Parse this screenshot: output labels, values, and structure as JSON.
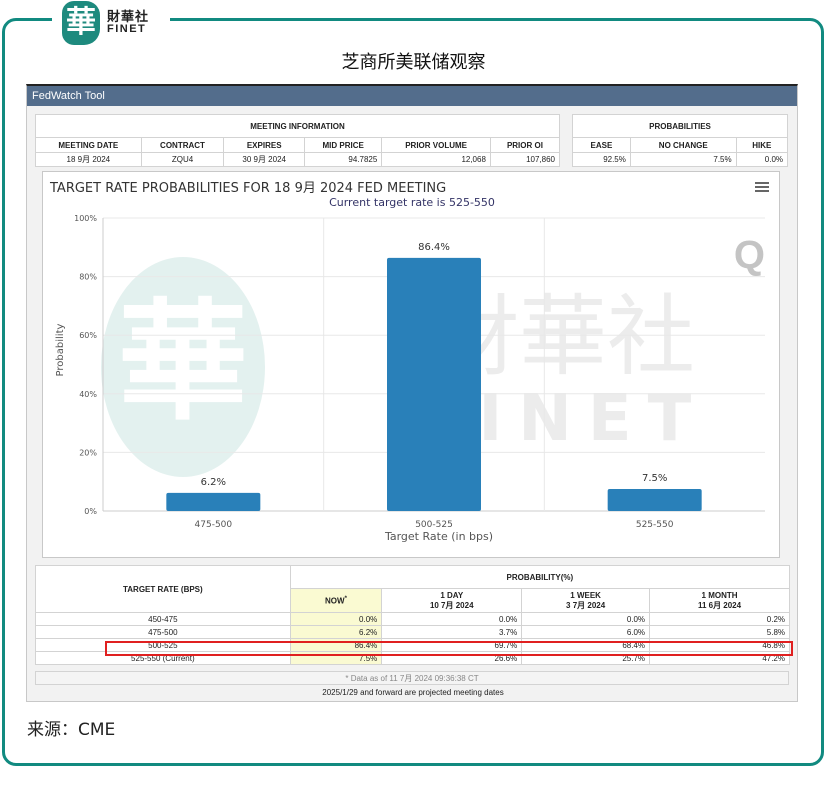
{
  "brand": {
    "logo_glyph": "華",
    "name_cn": "財華社",
    "name_en": "FINET"
  },
  "page_title": "芝商所美联储观察",
  "tool_title": "FedWatch Tool",
  "meeting_info": {
    "header": "MEETING INFORMATION",
    "columns": [
      "MEETING DATE",
      "CONTRACT",
      "EXPIRES",
      "MID PRICE",
      "PRIOR VOLUME",
      "PRIOR OI"
    ],
    "values": [
      "18 9月 2024",
      "ZQU4",
      "30 9月 2024",
      "94.7825",
      "12,068",
      "107,860"
    ]
  },
  "probabilities": {
    "header": "PROBABILITIES",
    "columns": [
      "EASE",
      "NO CHANGE",
      "HIKE"
    ],
    "values": [
      "92.5%",
      "7.5%",
      "0.0%"
    ]
  },
  "chart_menu_icon": "hamburger-menu-icon",
  "chart_data": {
    "type": "bar",
    "title": "TARGET RATE PROBABILITIES FOR 18 9月 2024 FED MEETING",
    "subtitle": "Current target rate is 525-550",
    "categories": [
      "475-500",
      "500-525",
      "525-550"
    ],
    "values": [
      6.2,
      86.4,
      7.5
    ],
    "data_labels": [
      "6.2%",
      "86.4%",
      "7.5%"
    ],
    "xlabel": "Target Rate (in bps)",
    "ylabel": "Probability",
    "ylim": [
      0,
      100
    ],
    "yticks": [
      "0%",
      "20%",
      "40%",
      "60%",
      "80%",
      "100%"
    ],
    "ytick_values": [
      0,
      20,
      40,
      60,
      80,
      100
    ],
    "grid": true,
    "bar_color": "#2980b9"
  },
  "prob_table": {
    "rate_header": "TARGET RATE (BPS)",
    "group_header": "PROBABILITY(%)",
    "columns": [
      {
        "label": "NOW",
        "sub": "",
        "marker": "*"
      },
      {
        "label": "1 DAY",
        "sub": "10 7月 2024"
      },
      {
        "label": "1 WEEK",
        "sub": "3 7月 2024"
      },
      {
        "label": "1 MONTH",
        "sub": "11 6月 2024"
      }
    ],
    "rows": [
      {
        "rate": "450-475",
        "values": [
          "0.0%",
          "0.0%",
          "0.0%",
          "0.2%"
        ]
      },
      {
        "rate": "475-500",
        "values": [
          "6.2%",
          "3.7%",
          "6.0%",
          "5.8%"
        ]
      },
      {
        "rate": "500-525",
        "values": [
          "86.4%",
          "69.7%",
          "68.4%",
          "46.8%"
        ],
        "highlighted": true
      },
      {
        "rate": "525-550 (Current)",
        "values": [
          "7.5%",
          "26.6%",
          "25.7%",
          "47.2%"
        ]
      }
    ],
    "footnote": "* Data as of 11 7月 2024 09:36:38 CT",
    "projection_note": "2025/1/29 and forward are projected meeting dates"
  },
  "highlight_color": "#e02020",
  "source": "来源：CME"
}
